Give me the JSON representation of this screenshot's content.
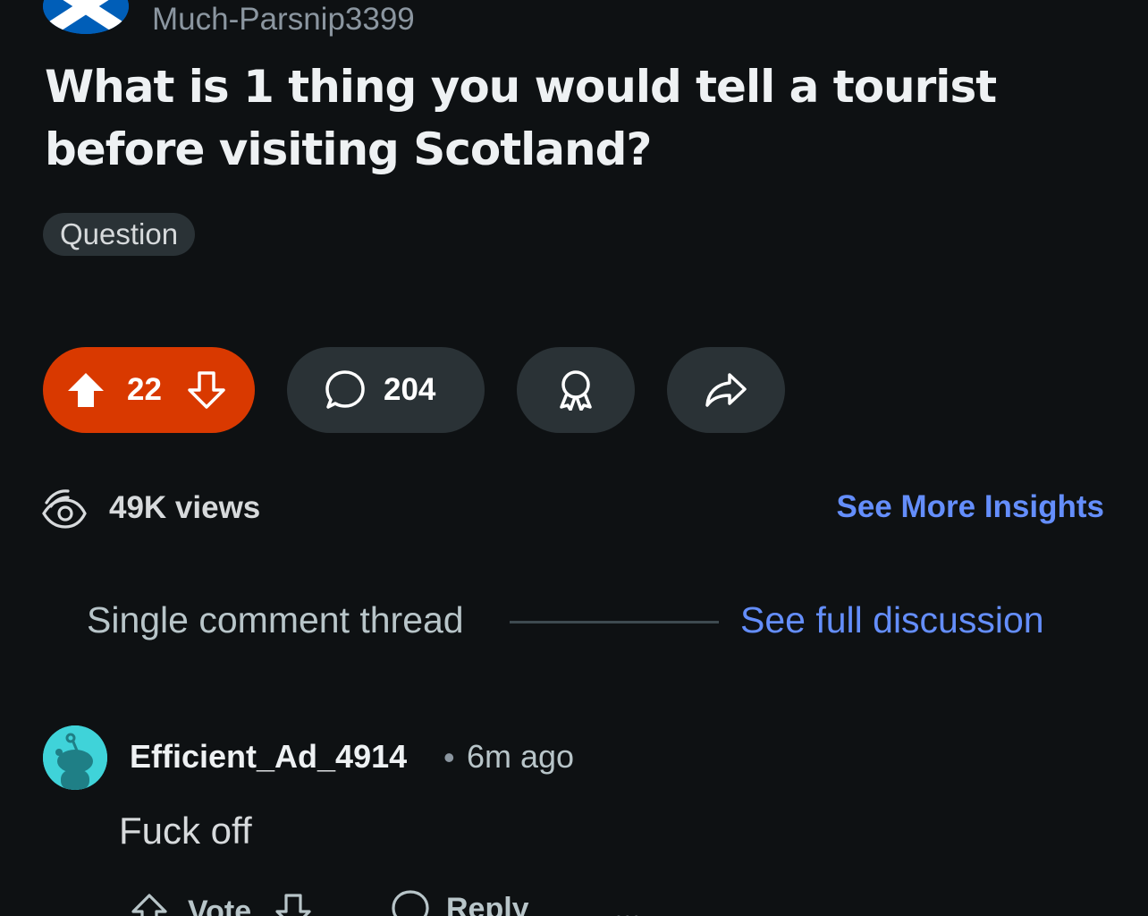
{
  "post": {
    "author": "Much-Parsnip3399",
    "title": "What is 1 thing you would tell a tourist before visiting Scotland?",
    "flair": "Question"
  },
  "actions": {
    "upvotes": "22",
    "comments": "204"
  },
  "insights": {
    "views": "49K views",
    "link": "See More Insights"
  },
  "thread": {
    "label": "Single comment thread",
    "link": "See full discussion"
  },
  "comment": {
    "author": "Efficient_Ad_4914",
    "separator": "•",
    "time": "6m ago",
    "body": "Fuck off",
    "vote_label": "Vote",
    "reply_label": "Reply",
    "more": "•••"
  },
  "colors": {
    "background": "#0e1113",
    "upvote_active": "#d93900",
    "link": "#648efc",
    "pill": "#2a3236"
  }
}
